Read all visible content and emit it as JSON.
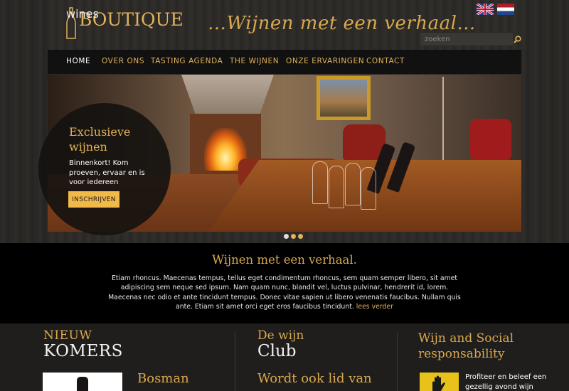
{
  "header": {
    "brand": "BOUTIQUE",
    "brand_sub": "wines",
    "tagline": "…Wijnen met een verhaal…",
    "search_placeholder": "zoeken",
    "flags": [
      "flag-uk-icon",
      "flag-nl-icon"
    ]
  },
  "nav": {
    "items": [
      {
        "label": "HOME",
        "active": true
      },
      {
        "label": "OVER ONS"
      },
      {
        "label": "TASTING AGENDA"
      },
      {
        "label": "THE WIJNEN"
      },
      {
        "label": "ONZE ERVARINGEN"
      },
      {
        "label": "CONTACT"
      }
    ]
  },
  "hero": {
    "promo_title": "Exclusieve wijnen",
    "promo_text": "Binnenkort! Kom proeven, ervaar en is voor iedereen",
    "promo_button": "INSCHRIJVEN",
    "slides": 3,
    "active_slide": 1
  },
  "intro": {
    "title": "Wijnen met een verhaal.",
    "body": "Etiam rhoncus. Maecenas tempus, tellus eget condimentum rhoncus, sem quam semper libero, sit amet adipiscing sem neque sed ipsum. Nam quam nunc, blandit vel, luctus pulvinar, hendrerit id, lorem. Maecenas nec odio et ante tincidunt tempus. Donec vitae sapien ut libero venenatis faucibus. Nullam quis ante. Etiam sit amet orci eget eros faucibus tincidunt.",
    "read_more": "lees verder"
  },
  "columns": {
    "nieuw": {
      "title_a": "NIEUW",
      "title_b": "KOMERS",
      "item_title": "Bosman"
    },
    "club": {
      "title_a": "De wijn",
      "title_b": "Club",
      "subtitle": "Wordt ook lid van"
    },
    "social": {
      "title_line1": "Wijn and Social",
      "title_line2": "responsability",
      "text": "Profiteer en beleef een gezellig avond wijn"
    }
  },
  "colors": {
    "accent": "#e0b25a",
    "background": "#1e1d1b",
    "band": "#000000"
  }
}
